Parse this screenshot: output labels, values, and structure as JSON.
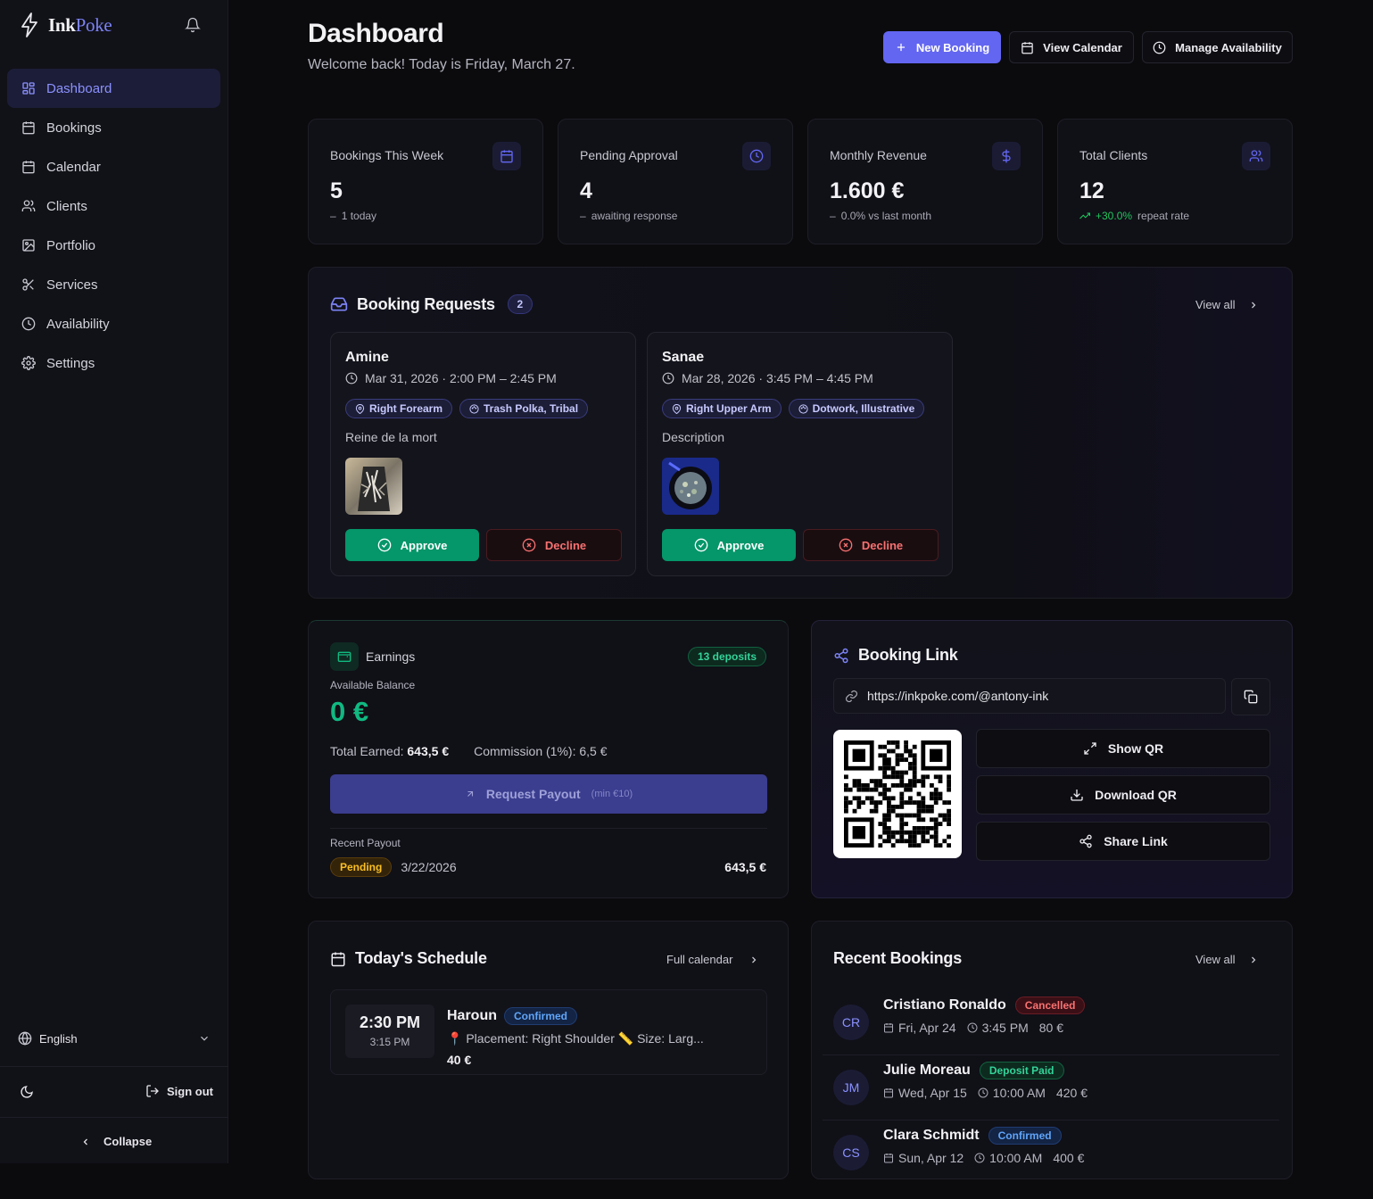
{
  "app": {
    "name_primary": "Ink",
    "name_accent": "Poke"
  },
  "sidebar": {
    "items": [
      {
        "label": "Dashboard",
        "icon": "grid-icon",
        "active": true
      },
      {
        "label": "Bookings",
        "icon": "calendar-grid-icon"
      },
      {
        "label": "Calendar",
        "icon": "calendar-icon"
      },
      {
        "label": "Clients",
        "icon": "users-icon"
      },
      {
        "label": "Portfolio",
        "icon": "image-icon"
      },
      {
        "label": "Services",
        "icon": "scissors-icon"
      },
      {
        "label": "Availability",
        "icon": "clock-icon"
      },
      {
        "label": "Settings",
        "icon": "gear-icon"
      }
    ],
    "language": "English",
    "sign_out": "Sign out",
    "collapse": "Collapse"
  },
  "header": {
    "title": "Dashboard",
    "subtitle": "Welcome back! Today is Friday, March 27.",
    "new_booking": "New Booking",
    "view_calendar": "View Calendar",
    "manage_availability": "Manage Availability"
  },
  "stats": [
    {
      "label": "Bookings This Week",
      "value": "5",
      "note_prefix": "–",
      "note": "1 today",
      "icon": "calendar-grid-icon"
    },
    {
      "label": "Pending Approval",
      "value": "4",
      "note_prefix": "–",
      "note": "awaiting response",
      "icon": "clock-icon"
    },
    {
      "label": "Monthly Revenue",
      "value": "1.600 €",
      "note_prefix": "–",
      "note": "0.0% vs last month",
      "icon": "dollar-icon"
    },
    {
      "label": "Total Clients",
      "value": "12",
      "note_highlight": "+30.0%",
      "note": "repeat rate",
      "icon": "users-icon"
    }
  ],
  "requests": {
    "title": "Booking Requests",
    "count": "2",
    "view_all": "View all",
    "items": [
      {
        "name": "Amine",
        "datetime": "Mar 31, 2026 · 2:00 PM – 2:45 PM",
        "placement": "Right Forearm",
        "styles": "Trash Polka, Tribal",
        "description": "Reine de la mort",
        "approve": "Approve",
        "decline": "Decline"
      },
      {
        "name": "Sanae",
        "datetime": "Mar 28, 2026 · 3:45 PM – 4:45 PM",
        "placement": "Right Upper Arm",
        "styles": "Dotwork, Illustrative",
        "description": "Description",
        "approve": "Approve",
        "decline": "Decline"
      }
    ]
  },
  "earnings": {
    "title": "Earnings",
    "deposits": "13 deposits",
    "balance_label": "Available Balance",
    "balance": "0 €",
    "total_earned_label": "Total Earned:",
    "total_earned": "643,5 €",
    "commission": "Commission (1%): 6,5 €",
    "payout_button": "Request Payout",
    "payout_min": "(min €10)",
    "recent_label": "Recent Payout",
    "recent_status": "Pending",
    "recent_date": "3/22/2026",
    "recent_amount": "643,5 €"
  },
  "booking_link": {
    "title": "Booking Link",
    "url": "https://inkpoke.com/@antony-ink",
    "show_qr": "Show QR",
    "download_qr": "Download QR",
    "share_link": "Share Link"
  },
  "schedule": {
    "title": "Today's Schedule",
    "full_calendar": "Full calendar",
    "items": [
      {
        "start": "2:30 PM",
        "end": "3:15 PM",
        "name": "Haroun",
        "status": "Confirmed",
        "details": "📍 Placement: Right Shoulder 📏 Size: Larg...",
        "price": "40 €"
      }
    ]
  },
  "recent_bookings": {
    "title": "Recent Bookings",
    "view_all": "View all",
    "items": [
      {
        "initials": "CR",
        "name": "Cristiano Ronaldo",
        "status": "Cancelled",
        "date": "Fri, Apr 24",
        "time": "3:45 PM",
        "price": "80 €"
      },
      {
        "initials": "JM",
        "name": "Julie Moreau",
        "status": "Deposit Paid",
        "date": "Wed, Apr 15",
        "time": "10:00 AM",
        "price": "420 €"
      },
      {
        "initials": "CS",
        "name": "Clara Schmidt",
        "status": "Confirmed",
        "date": "Sun, Apr 12",
        "time": "10:00 AM",
        "price": "400 €"
      }
    ]
  },
  "colors": {
    "accent": "#6366f1",
    "success": "#059669",
    "danger": "#f87171",
    "warning": "#fbbf24",
    "background": "#0b0b0e"
  }
}
